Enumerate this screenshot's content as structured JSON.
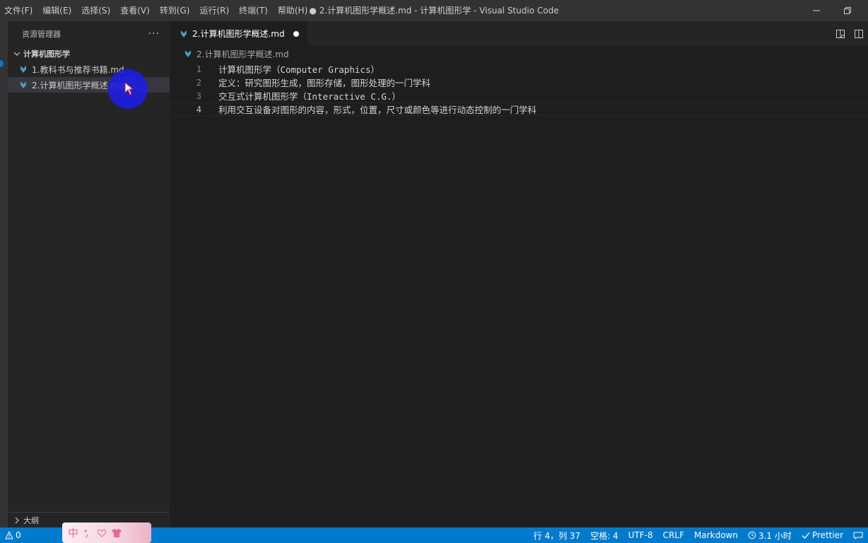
{
  "menubar": {
    "items": [
      "文件(F)",
      "编辑(E)",
      "选择(S)",
      "查看(V)",
      "转到(G)",
      "运行(R)",
      "终端(T)",
      "帮助(H)"
    ]
  },
  "window": {
    "title": "● 2.计算机图形学概述.md - 计算机图形学 - Visual Studio Code"
  },
  "sidebar": {
    "title": "资源管理器",
    "more": "···",
    "folder": "计算机图形学",
    "files": [
      {
        "label": "1.教科书与推荐书籍.md",
        "active": false
      },
      {
        "label": "2.计算机图形学概述.md",
        "active": true
      }
    ],
    "outline": "大纲"
  },
  "editor": {
    "tab_label": "2.计算机图形学概述.md",
    "breadcrumb": "2.计算机图形学概述.md",
    "lines": [
      {
        "num": "1",
        "text": "计算机图形学（Computer Graphics）"
      },
      {
        "num": "2",
        "text": "定义：研究图形生成，图形存储，图形处理的一门学科"
      },
      {
        "num": "3",
        "text": "交互式计算机图形学（Interactive C.G.）"
      },
      {
        "num": "4",
        "text": "利用交互设备对图形的内容，形式，位置，尺寸或颜色等进行动态控制的一门学科"
      }
    ],
    "current_line": 4
  },
  "statusbar": {
    "problems": "0",
    "position": "行 4，列 37",
    "spaces": "空格: 4",
    "encoding": "UTF-8",
    "eol": "CRLF",
    "language": "Markdown",
    "time": "3.1 小时",
    "prettier": "Prettier"
  },
  "ime": {
    "label": "中"
  },
  "colors": {
    "accent": "#007acc",
    "titlebar": "#333333",
    "sidebar": "#252526",
    "editor": "#1e1e1e",
    "markdown_icon": "#519aba"
  }
}
